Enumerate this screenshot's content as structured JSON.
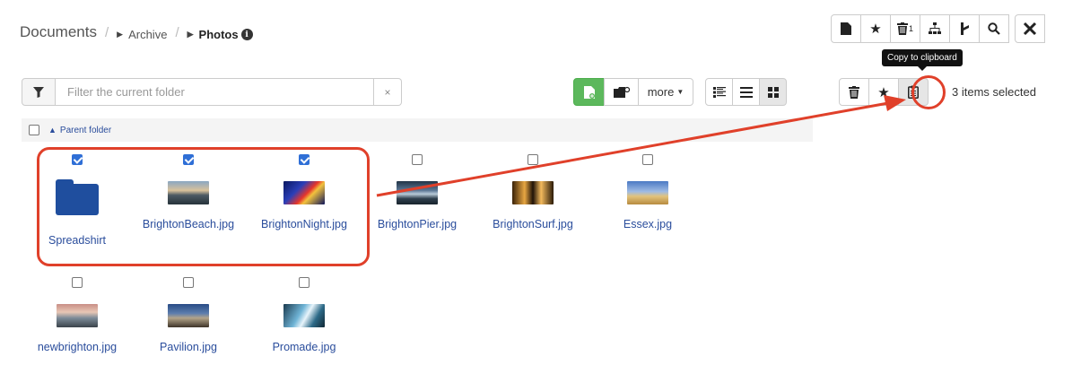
{
  "breadcrumb": {
    "root": "Documents",
    "separator": "/",
    "items": [
      "Archive",
      "Photos"
    ],
    "info_icon": "i"
  },
  "top_toolbar": {
    "buttons": [
      {
        "icon": "file-icon",
        "glyph": "🗎"
      },
      {
        "icon": "star-icon",
        "glyph": "★"
      },
      {
        "icon": "trash-icon",
        "glyph": "🗑",
        "badge": "1"
      },
      {
        "icon": "sitemap-icon",
        "glyph": "⑂"
      },
      {
        "icon": "branch-icon",
        "glyph": "⮧"
      },
      {
        "icon": "search-icon",
        "glyph": "⌕"
      },
      {
        "icon": "tools-icon",
        "glyph": "⚒"
      }
    ]
  },
  "filter": {
    "placeholder": "Filter the current folder",
    "value": "",
    "clear": "×"
  },
  "actions": {
    "more_label": "more"
  },
  "selection": {
    "count_text": "3 items selected",
    "tooltip": "Copy to clipboard"
  },
  "parent_folder": {
    "label": "Parent folder"
  },
  "items": [
    {
      "name": "Spreadshirt",
      "type": "folder",
      "checked": true
    },
    {
      "name": "BrightonBeach.jpg",
      "type": "image",
      "thumb": "t-beach",
      "checked": true
    },
    {
      "name": "BrightonNight.jpg",
      "type": "image",
      "thumb": "t-night",
      "checked": true
    },
    {
      "name": "BrightonPier.jpg",
      "type": "image",
      "thumb": "t-pier",
      "checked": false
    },
    {
      "name": "BrightonSurf.jpg",
      "type": "image",
      "thumb": "t-surf",
      "checked": false
    },
    {
      "name": "Essex.jpg",
      "type": "image",
      "thumb": "t-essex",
      "checked": false
    },
    {
      "name": "newbrighton.jpg",
      "type": "image",
      "thumb": "t-newb",
      "checked": false
    },
    {
      "name": "Pavilion.jpg",
      "type": "image",
      "thumb": "t-pav",
      "checked": false
    },
    {
      "name": "Promade.jpg",
      "type": "image",
      "thumb": "t-prom",
      "checked": false
    }
  ],
  "colors": {
    "accent": "#2f6fd6",
    "link": "#2a4d9c",
    "success": "#5cb85c",
    "annotation": "#e0402a"
  }
}
